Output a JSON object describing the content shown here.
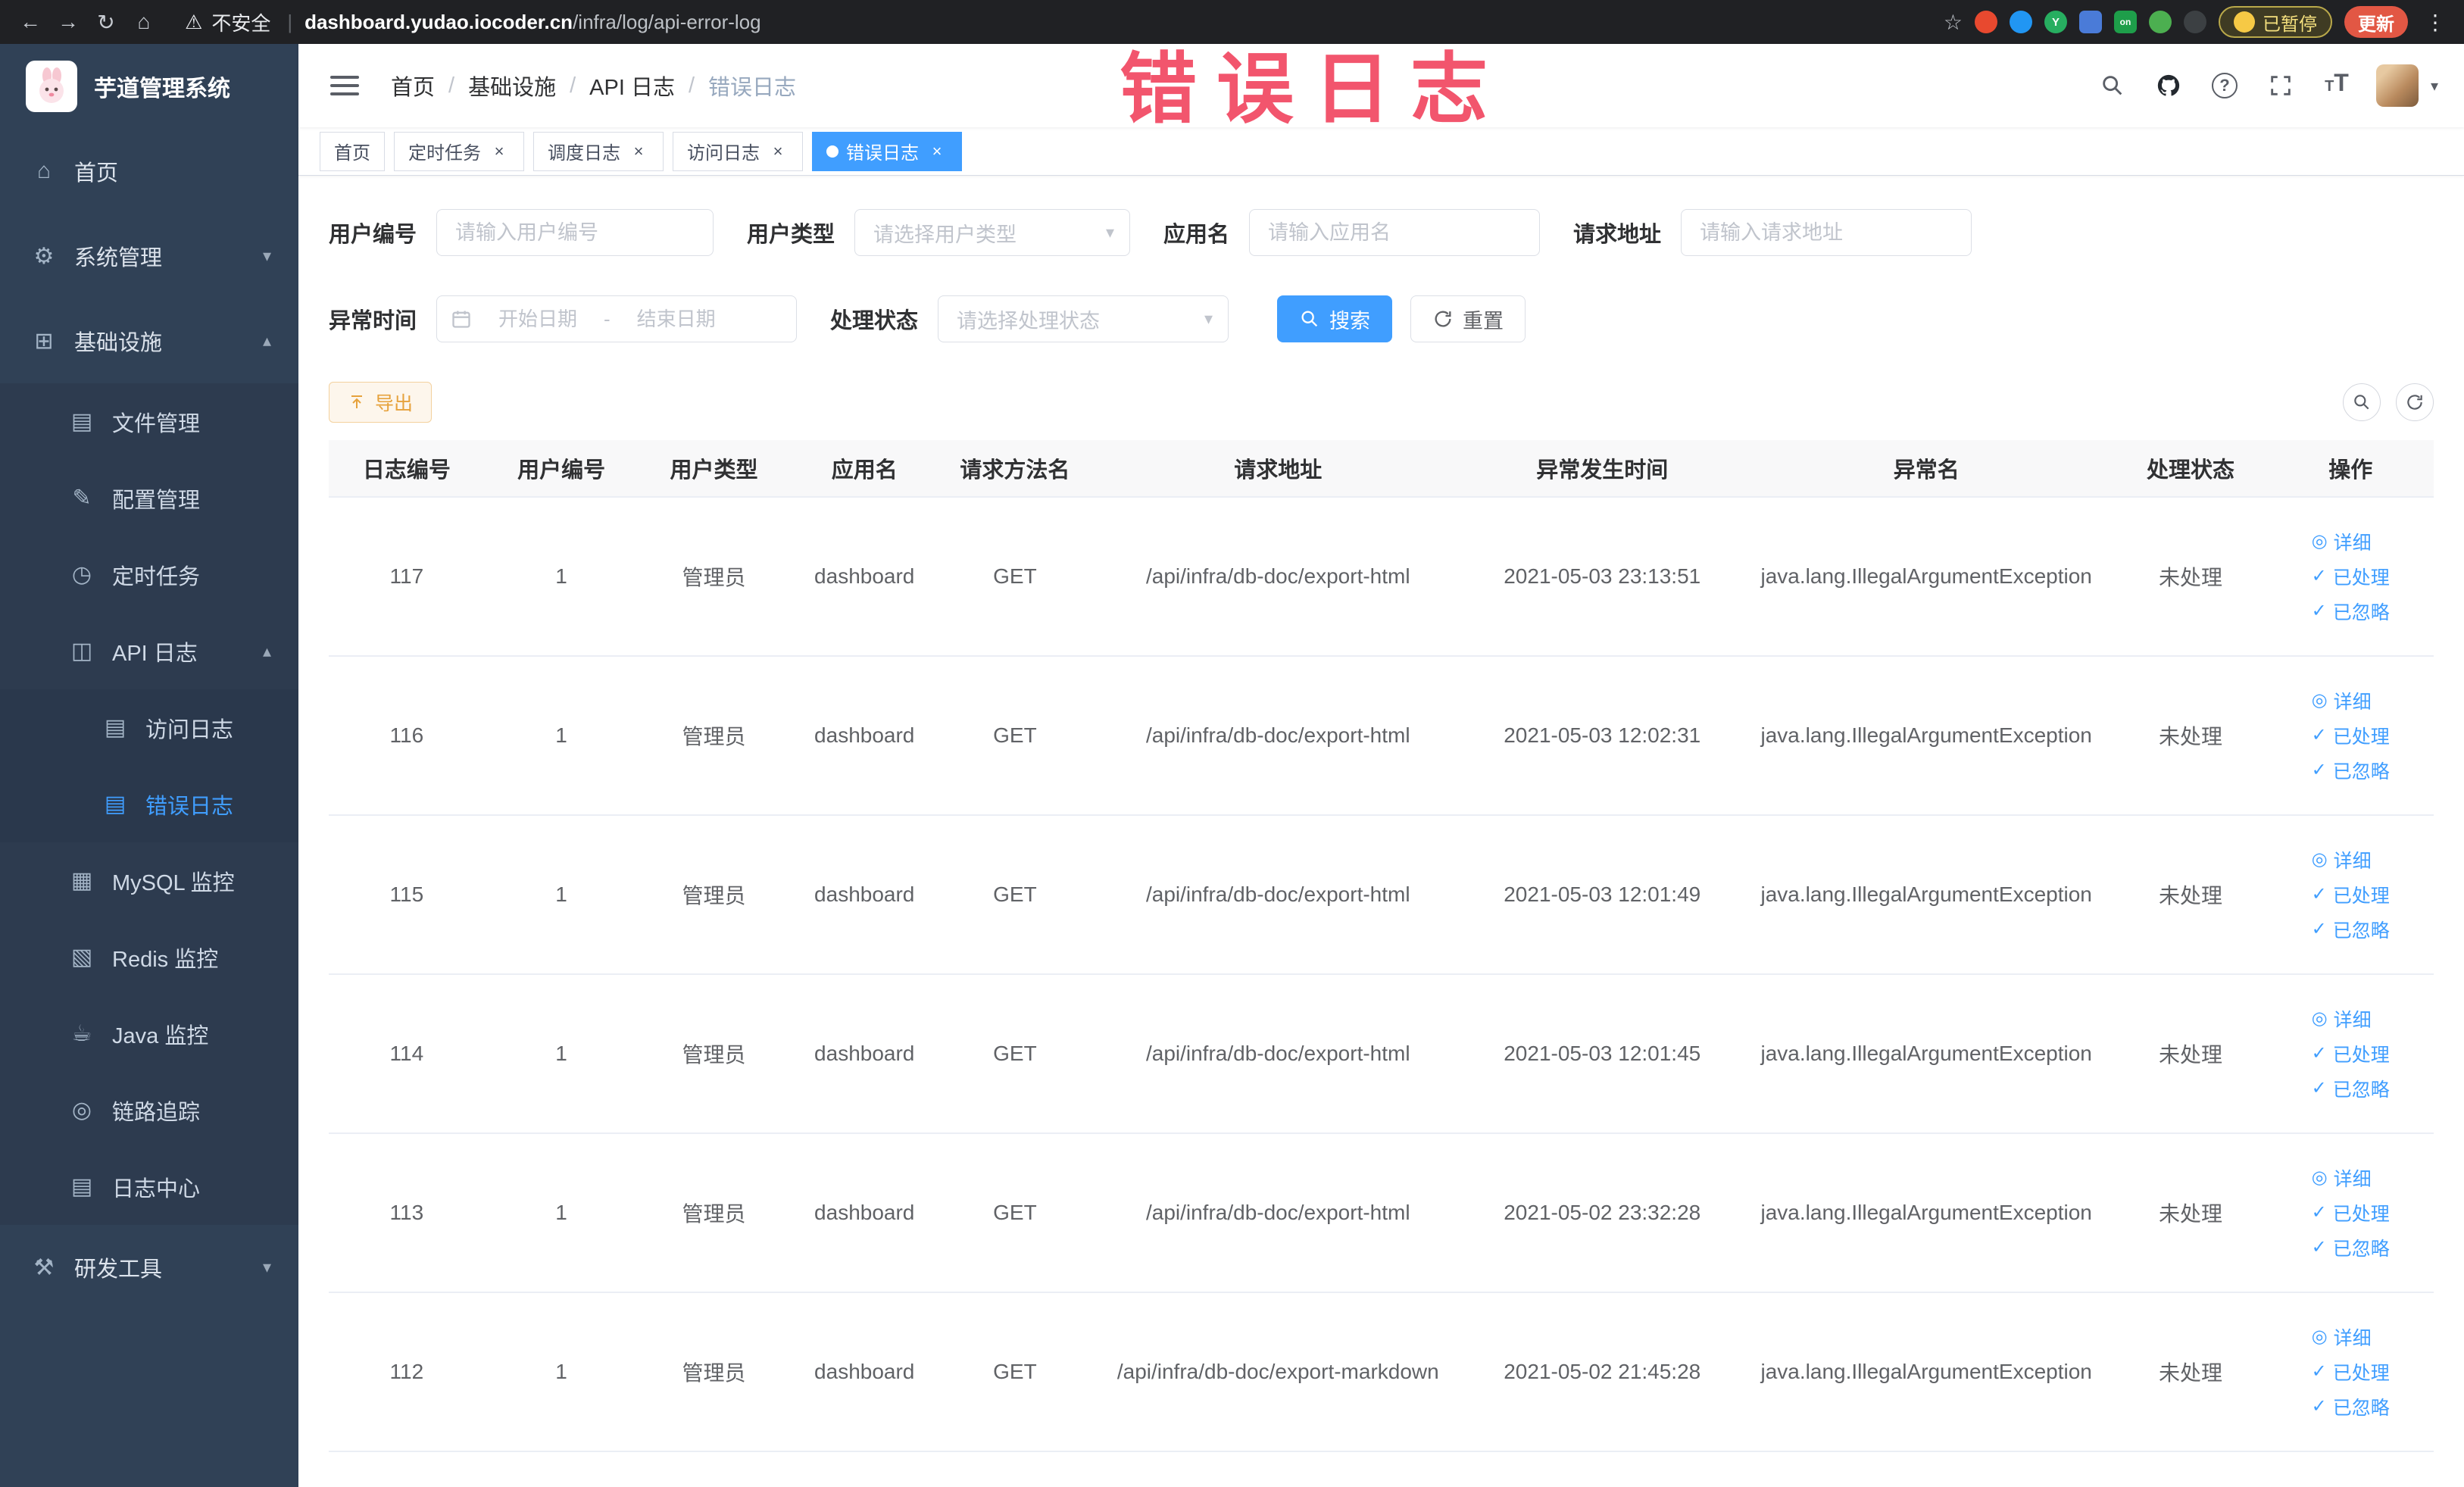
{
  "browser": {
    "security_label": "不安全",
    "url_domain": "dashboard.yudao.iocoder.cn",
    "url_path": "/infra/log/api-error-log",
    "paused_label": "已暂停",
    "update_label": "更新"
  },
  "annotation": {
    "text": "错误日志"
  },
  "sidebar": {
    "app_title": "芋道管理系统",
    "items": [
      {
        "label": "首页"
      },
      {
        "label": "系统管理"
      },
      {
        "label": "基础设施"
      },
      {
        "label": "文件管理"
      },
      {
        "label": "配置管理"
      },
      {
        "label": "定时任务"
      },
      {
        "label": "API 日志"
      },
      {
        "label": "访问日志"
      },
      {
        "label": "错误日志"
      },
      {
        "label": "MySQL 监控"
      },
      {
        "label": "Redis 监控"
      },
      {
        "label": "Java 监控"
      },
      {
        "label": "链路追踪"
      },
      {
        "label": "日志中心"
      },
      {
        "label": "研发工具"
      }
    ]
  },
  "header": {
    "breadcrumbs": [
      "首页",
      "基础设施",
      "API 日志",
      "错误日志"
    ],
    "breadcrumb_separator": "/"
  },
  "tabs": [
    {
      "label": "首页"
    },
    {
      "label": "定时任务"
    },
    {
      "label": "调度日志"
    },
    {
      "label": "访问日志"
    },
    {
      "label": "错误日志"
    }
  ],
  "filters": {
    "user_id_label": "用户编号",
    "user_id_placeholder": "请输入用户编号",
    "user_type_label": "用户类型",
    "user_type_placeholder": "请选择用户类型",
    "app_name_label": "应用名",
    "app_name_placeholder": "请输入应用名",
    "request_url_label": "请求地址",
    "request_url_placeholder": "请输入请求地址",
    "exception_time_label": "异常时间",
    "start_date_placeholder": "开始日期",
    "date_separator": "-",
    "end_date_placeholder": "结束日期",
    "process_status_label": "处理状态",
    "process_status_placeholder": "请选择处理状态",
    "search_label": "搜索",
    "reset_label": "重置"
  },
  "toolbar": {
    "export_label": "导出"
  },
  "table": {
    "columns": [
      "日志编号",
      "用户编号",
      "用户类型",
      "应用名",
      "请求方法名",
      "请求地址",
      "异常发生时间",
      "异常名",
      "处理状态",
      "操作"
    ],
    "action_labels": {
      "detail": "详细",
      "processed": "已处理",
      "ignored": "已忽略"
    },
    "rows": [
      {
        "id": "117",
        "user_id": "1",
        "user_type": "管理员",
        "app": "dashboard",
        "method": "GET",
        "url": "/api/infra/db-doc/export-html",
        "time": "2021-05-03 23:13:51",
        "exception": "java.lang.IllegalArgumentException",
        "status": "未处理"
      },
      {
        "id": "116",
        "user_id": "1",
        "user_type": "管理员",
        "app": "dashboard",
        "method": "GET",
        "url": "/api/infra/db-doc/export-html",
        "time": "2021-05-03 12:02:31",
        "exception": "java.lang.IllegalArgumentException",
        "status": "未处理"
      },
      {
        "id": "115",
        "user_id": "1",
        "user_type": "管理员",
        "app": "dashboard",
        "method": "GET",
        "url": "/api/infra/db-doc/export-html",
        "time": "2021-05-03 12:01:49",
        "exception": "java.lang.IllegalArgumentException",
        "status": "未处理"
      },
      {
        "id": "114",
        "user_id": "1",
        "user_type": "管理员",
        "app": "dashboard",
        "method": "GET",
        "url": "/api/infra/db-doc/export-html",
        "time": "2021-05-03 12:01:45",
        "exception": "java.lang.IllegalArgumentException",
        "status": "未处理"
      },
      {
        "id": "113",
        "user_id": "1",
        "user_type": "管理员",
        "app": "dashboard",
        "method": "GET",
        "url": "/api/infra/db-doc/export-html",
        "time": "2021-05-02 23:32:28",
        "exception": "java.lang.IllegalArgumentException",
        "status": "未处理"
      },
      {
        "id": "112",
        "user_id": "1",
        "user_type": "管理员",
        "app": "dashboard",
        "method": "GET",
        "url": "/api/infra/db-doc/export-markdown",
        "time": "2021-05-02 21:45:28",
        "exception": "java.lang.IllegalArgumentException",
        "status": "未处理"
      }
    ]
  }
}
